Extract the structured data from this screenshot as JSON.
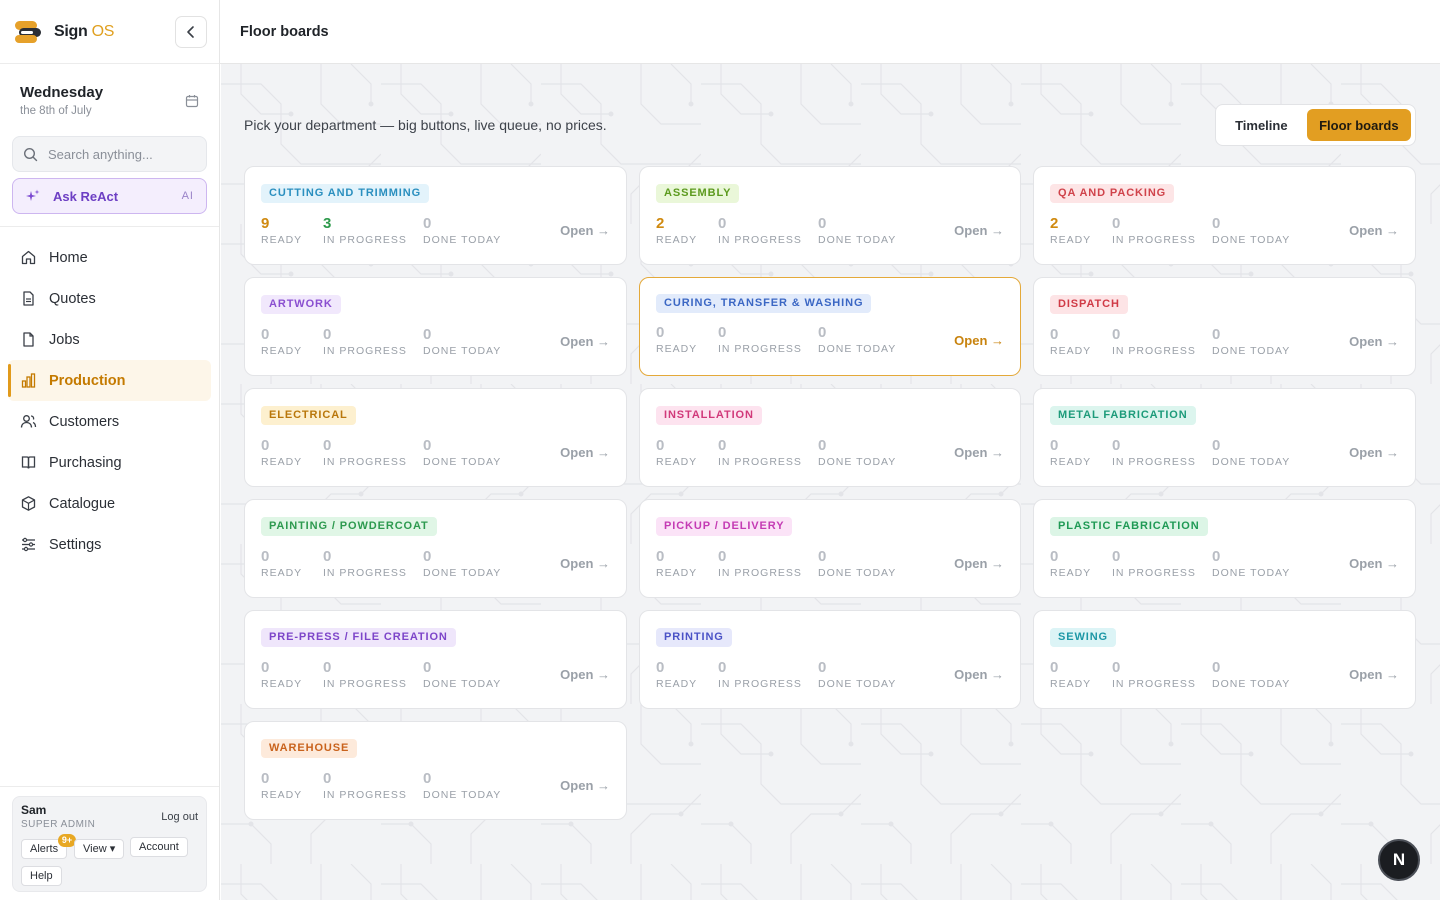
{
  "brand": {
    "name_main": "Sign",
    "name_accent": "OS"
  },
  "sidebar": {
    "date_day": "Wednesday",
    "date_sub": "the 8th of July",
    "search_placeholder": "Search anything...",
    "ask_label": "Ask ReAct",
    "ask_badge": "AI",
    "items": [
      {
        "label": "Home",
        "icon": "home-icon"
      },
      {
        "label": "Quotes",
        "icon": "document-icon"
      },
      {
        "label": "Jobs",
        "icon": "briefcase-icon"
      },
      {
        "label": "Production",
        "icon": "bar-chart-icon",
        "active": true
      },
      {
        "label": "Customers",
        "icon": "users-icon"
      },
      {
        "label": "Purchasing",
        "icon": "book-icon"
      },
      {
        "label": "Catalogue",
        "icon": "box-icon"
      },
      {
        "label": "Settings",
        "icon": "sliders-icon"
      }
    ],
    "user": {
      "name": "Sam",
      "role": "SUPER ADMIN",
      "logout": "Log out",
      "alerts": "Alerts",
      "alerts_badge": "9+",
      "view": "View ▾",
      "account": "Account",
      "help": "Help"
    }
  },
  "header": {
    "title": "Floor boards"
  },
  "main": {
    "intro": "Pick your department — big buttons, live queue, no prices.",
    "toggle": {
      "timeline": "Timeline",
      "floor_boards": "Floor boards",
      "selected": "Floor boards"
    },
    "stat_labels": {
      "ready": "READY",
      "in_progress": "IN PROGRESS",
      "done_today": "DONE TODAY"
    },
    "open_label": "Open →",
    "departments": [
      {
        "name": "CUTTING AND TRIMMING",
        "ready": "9",
        "in_progress": "3",
        "done_today": "0",
        "tag_bg": "#e3f3fb",
        "tag_fg": "#2a8fbf"
      },
      {
        "name": "ASSEMBLY",
        "ready": "2",
        "in_progress": "0",
        "done_today": "0",
        "tag_bg": "#eaf7d9",
        "tag_fg": "#5c9a1e"
      },
      {
        "name": "QA AND PACKING",
        "ready": "2",
        "in_progress": "0",
        "done_today": "0",
        "tag_bg": "#fde5e6",
        "tag_fg": "#d0434b"
      },
      {
        "name": "ARTWORK",
        "ready": "0",
        "in_progress": "0",
        "done_today": "0",
        "tag_bg": "#f1e8fc",
        "tag_fg": "#8a4fd0"
      },
      {
        "name": "CURING, TRANSFER & WASHING",
        "ready": "0",
        "in_progress": "0",
        "done_today": "0",
        "tag_bg": "#e2ebfb",
        "tag_fg": "#3b67c4",
        "highlight": true
      },
      {
        "name": "DISPATCH",
        "ready": "0",
        "in_progress": "0",
        "done_today": "0",
        "tag_bg": "#fde4e6",
        "tag_fg": "#d03a46"
      },
      {
        "name": "ELECTRICAL",
        "ready": "0",
        "in_progress": "0",
        "done_today": "0",
        "tag_bg": "#fdf0cf",
        "tag_fg": "#b9770b"
      },
      {
        "name": "INSTALLATION",
        "ready": "0",
        "in_progress": "0",
        "done_today": "0",
        "tag_bg": "#fde3ef",
        "tag_fg": "#d1397a"
      },
      {
        "name": "METAL FABRICATION",
        "ready": "0",
        "in_progress": "0",
        "done_today": "0",
        "tag_bg": "#dcf5ee",
        "tag_fg": "#1d9b7a"
      },
      {
        "name": "PAINTING / POWDERCOAT",
        "ready": "0",
        "in_progress": "0",
        "done_today": "0",
        "tag_bg": "#e0f6e6",
        "tag_fg": "#2d9a4f"
      },
      {
        "name": "PICKUP / DELIVERY",
        "ready": "0",
        "in_progress": "0",
        "done_today": "0",
        "tag_bg": "#fbe3f7",
        "tag_fg": "#c43bb4"
      },
      {
        "name": "PLASTIC FABRICATION",
        "ready": "0",
        "in_progress": "0",
        "done_today": "0",
        "tag_bg": "#dcf5e6",
        "tag_fg": "#1f9a55"
      },
      {
        "name": "PRE-PRESS / FILE CREATION",
        "ready": "0",
        "in_progress": "0",
        "done_today": "0",
        "tag_bg": "#efe6fb",
        "tag_fg": "#7d45c9"
      },
      {
        "name": "PRINTING",
        "ready": "0",
        "in_progress": "0",
        "done_today": "0",
        "tag_bg": "#e6e8fb",
        "tag_fg": "#4a52c6"
      },
      {
        "name": "SEWING",
        "ready": "0",
        "in_progress": "0",
        "done_today": "0",
        "tag_bg": "#dcf4f6",
        "tag_fg": "#1d97a6"
      },
      {
        "name": "WAREHOUSE",
        "ready": "0",
        "in_progress": "0",
        "done_today": "0",
        "tag_bg": "#fdeadb",
        "tag_fg": "#c9631d"
      }
    ]
  },
  "fab": {
    "label": "N",
    "icon": "next-logo-icon"
  }
}
